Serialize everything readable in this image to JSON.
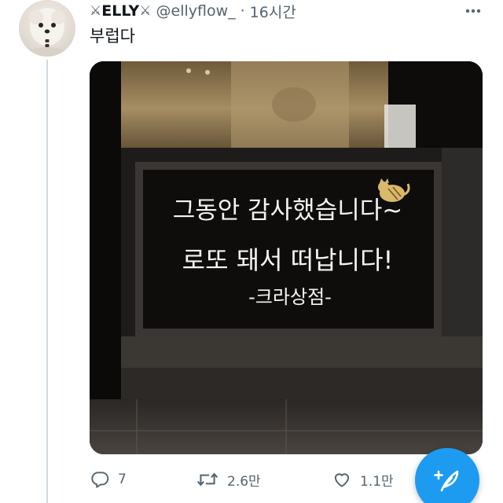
{
  "tweet": {
    "display_name": "ELLY",
    "handle": "@ellyflow_",
    "separator": "·",
    "time": "16시간",
    "text": "부럽다",
    "image": {
      "sign_line1": "그동안 감사했습니다~",
      "sign_line2": "로또 돼서 떠납니다!",
      "sign_line3": "-크라상점-"
    }
  },
  "actions": {
    "reply_count": "7",
    "retweet_count": "2.6만",
    "like_count": "1.1만"
  },
  "colors": {
    "accent": "#1d9bf0",
    "secondary_text": "#536471",
    "thread_line": "#cfd9de"
  }
}
